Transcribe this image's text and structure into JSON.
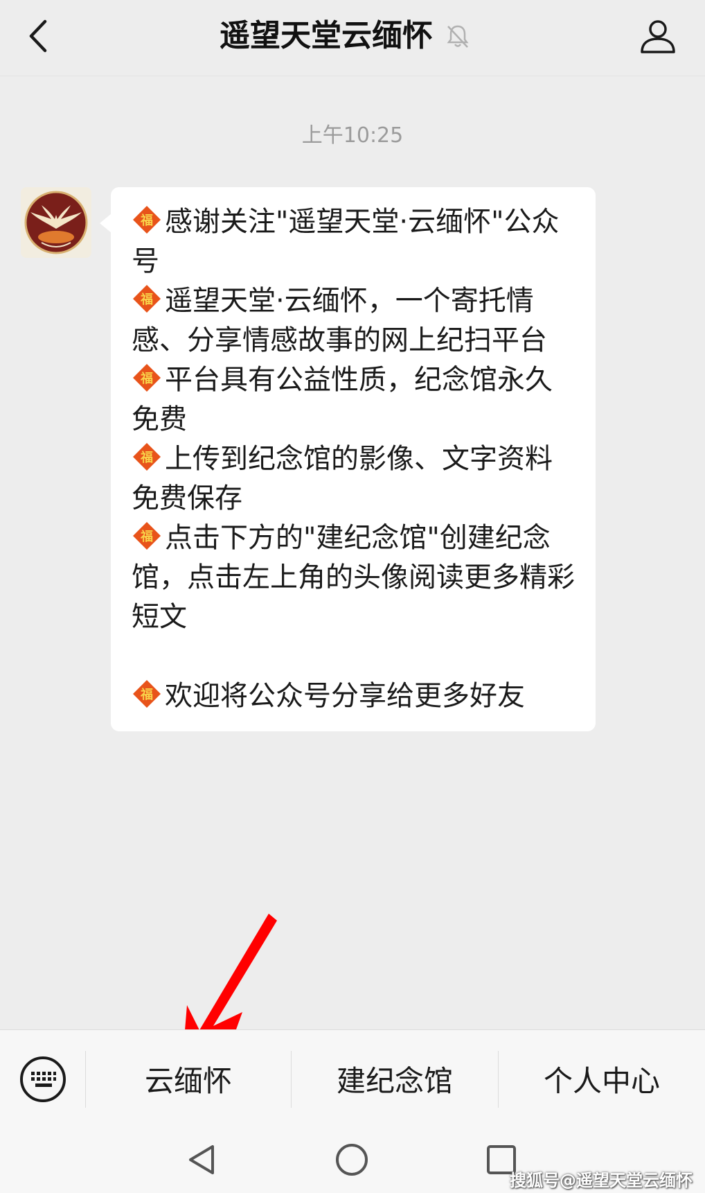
{
  "header": {
    "title": "遥望天堂云缅怀",
    "icons": {
      "back": "chevron-left-icon",
      "mute": "bell-muted-icon",
      "profile": "person-icon"
    }
  },
  "chat": {
    "timestamp": "上午10:25",
    "avatar_icon": "phoenix-logo-avatar",
    "message": {
      "bullet_icon": "fu-diamond-icon",
      "paragraphs": [
        "感谢关注\"遥望天堂·云缅怀\"公众号",
        "遥望天堂·云缅怀，一个寄托情感、分享情感故事的网上纪扫平台",
        "平台具有公益性质，纪念馆永久免费",
        "上传到纪念馆的影像、文字资料免费保存",
        "点击下方的\"建纪念馆\"创建纪念馆，点击左上角的头像阅读更多精彩短文",
        "欢迎将公众号分享给更多好友"
      ]
    }
  },
  "annotation": {
    "arrow_color": "#ff0000"
  },
  "menu": {
    "keyboard_icon": "keyboard-icon",
    "items": [
      {
        "label": "云缅怀"
      },
      {
        "label": "建纪念馆"
      },
      {
        "label": "个人中心"
      }
    ]
  },
  "navbar": {
    "icons": [
      "back-triangle-icon",
      "home-circle-icon",
      "recents-square-icon"
    ]
  },
  "watermark": "搜狐号@遥望天堂云缅怀",
  "colors": {
    "background": "#ededed",
    "bubble": "#ffffff",
    "menu_bar": "#f7f7f7",
    "fu_orange": "#e8531a"
  }
}
